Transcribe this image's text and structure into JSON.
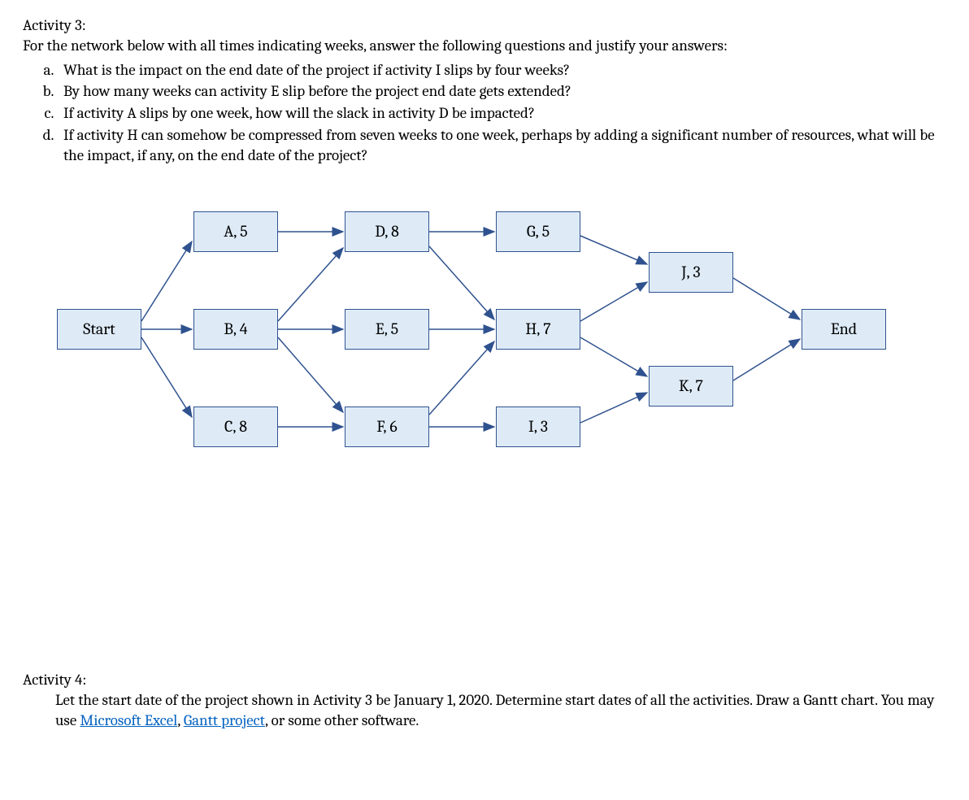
{
  "activity3": {
    "title": "Activity 3:",
    "intro": "For the network below with all times indicating weeks, answer the following questions and justify your answers:",
    "questions": [
      "What is the impact on the end date of the project if activity I slips by four weeks?",
      "By how many weeks can activity E slip before the project end date gets extended?",
      "If activity A slips by one week, how will the slack in activity D be impacted?",
      "If activity H can somehow be compressed from seven weeks to one week, perhaps by adding a significant number of resources, what will be the impact, if any, on the end date of the project?"
    ]
  },
  "network": {
    "nodes": {
      "start": "Start",
      "a": "A, 5",
      "b": "B, 4",
      "c": "C, 8",
      "d": "D, 8",
      "e": "E, 5",
      "f": "F, 6",
      "g": "G, 5",
      "h": "H, 7",
      "i": "I, 3",
      "j": "J, 3",
      "k": "K, 7",
      "end": "End"
    },
    "edges": [
      [
        "start",
        "a"
      ],
      [
        "start",
        "b"
      ],
      [
        "start",
        "c"
      ],
      [
        "a",
        "d"
      ],
      [
        "b",
        "d"
      ],
      [
        "b",
        "e"
      ],
      [
        "b",
        "f"
      ],
      [
        "c",
        "f"
      ],
      [
        "d",
        "g"
      ],
      [
        "d",
        "h"
      ],
      [
        "e",
        "h"
      ],
      [
        "f",
        "h"
      ],
      [
        "f",
        "i"
      ],
      [
        "g",
        "j"
      ],
      [
        "h",
        "j"
      ],
      [
        "h",
        "k"
      ],
      [
        "i",
        "k"
      ],
      [
        "j",
        "end"
      ],
      [
        "k",
        "end"
      ]
    ]
  },
  "activity4": {
    "title": "Activity 4:",
    "body_pre": "Let the start date of the project shown in Activity 3 be January 1, 2020. Determine start dates of all the activities. Draw a Gantt chart. You may use ",
    "link1": "Microsoft Excel",
    "body_mid": ", ",
    "link2": "Gantt project",
    "body_post": ", or some other software."
  }
}
